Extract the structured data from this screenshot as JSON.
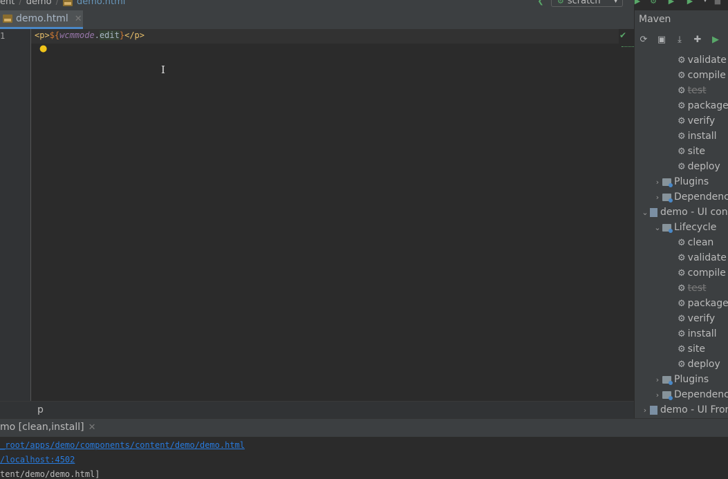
{
  "breadcrumb": {
    "items": [
      "ent",
      "demo"
    ],
    "file": "demo.html"
  },
  "run_config": {
    "label": "scratch"
  },
  "editor": {
    "tab_label": "demo.html",
    "line_number": "1",
    "code": {
      "open_tag": "<p>",
      "dollar": "${",
      "var": "wcmmode",
      "dot": ".",
      "prop": "edit",
      "close_brace": "}",
      "close_tag": "</p>"
    },
    "footer_crumb": "p"
  },
  "maven": {
    "title": "Maven",
    "toolbar_icons": [
      "refresh-icon",
      "add-folder-icon",
      "download-icon",
      "add-icon",
      "run-icon"
    ],
    "tree": [
      {
        "label": "validate",
        "type": "goal"
      },
      {
        "label": "compile",
        "type": "goal"
      },
      {
        "label": "test",
        "type": "goal",
        "disabled": true
      },
      {
        "label": "package",
        "type": "goal"
      },
      {
        "label": "verify",
        "type": "goal"
      },
      {
        "label": "install",
        "type": "goal"
      },
      {
        "label": "site",
        "type": "goal"
      },
      {
        "label": "deploy",
        "type": "goal"
      },
      {
        "label": "Plugins",
        "type": "folder"
      },
      {
        "label": "Dependencies",
        "type": "folder"
      },
      {
        "label": "demo - UI content",
        "type": "project"
      },
      {
        "label": "Lifecycle",
        "type": "folder"
      },
      {
        "label": "clean",
        "type": "goal"
      },
      {
        "label": "validate",
        "type": "goal"
      },
      {
        "label": "compile",
        "type": "goal"
      },
      {
        "label": "test",
        "type": "goal",
        "disabled": true
      },
      {
        "label": "package",
        "type": "goal"
      },
      {
        "label": "verify",
        "type": "goal"
      },
      {
        "label": "install",
        "type": "goal"
      },
      {
        "label": "site",
        "type": "goal"
      },
      {
        "label": "deploy",
        "type": "goal"
      },
      {
        "label": "Plugins",
        "type": "folder"
      },
      {
        "label": "Dependencies",
        "type": "folder"
      },
      {
        "label": "demo - UI Frontend",
        "type": "project"
      }
    ]
  },
  "run": {
    "tab_label": "mo [clean,install]",
    "console": [
      {
        "text": "_root/apps/demo/components/content/demo/demo.html",
        "link": true
      },
      {
        "text": "/localhost:4502",
        "link": true
      },
      {
        "text": "tent/demo/demo.html]",
        "link": false
      }
    ]
  }
}
